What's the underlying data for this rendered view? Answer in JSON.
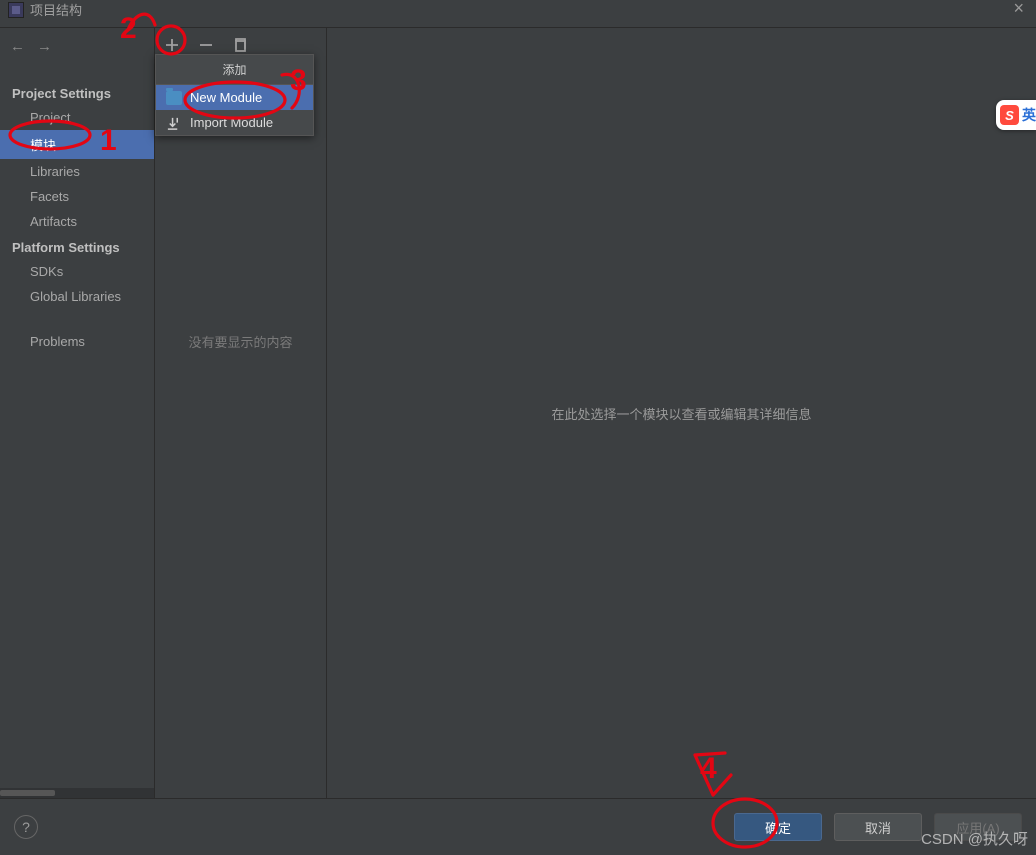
{
  "window": {
    "title": "项目结构"
  },
  "sidebar": {
    "headings": {
      "project": "Project Settings",
      "platform": "Platform Settings"
    },
    "items": {
      "project": "Project",
      "modules": "模块",
      "libraries": "Libraries",
      "facets": "Facets",
      "artifacts": "Artifacts",
      "sdks": "SDKs",
      "globalLibs": "Global Libraries",
      "problems": "Problems"
    }
  },
  "midPanel": {
    "emptyText": "没有要显示的内容"
  },
  "popup": {
    "title": "添加",
    "newModule": "New Module",
    "importModule": "Import Module"
  },
  "mainHint": "在此处选择一个模块以查看或编辑其详细信息",
  "buttons": {
    "ok": "确定",
    "cancel": "取消",
    "apply": "应用(A)"
  },
  "ime": {
    "letter": "S",
    "label": "英"
  },
  "watermark": "CSDN @执久呀",
  "annotations": {
    "n1": "1",
    "n2": "2",
    "n3": "3",
    "n4": "4"
  }
}
